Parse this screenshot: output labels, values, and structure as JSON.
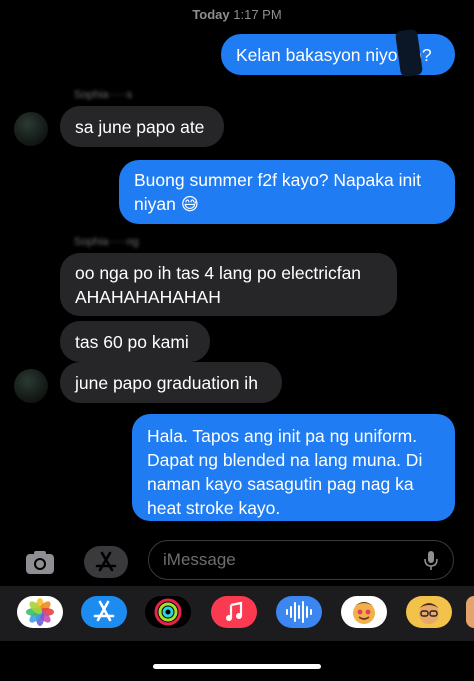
{
  "header": {
    "timestamp_day": "Today",
    "timestamp_time": "1:17 PM"
  },
  "messages": [
    {
      "text": "Kelan bakasyon niyo po?"
    },
    {
      "text": "sa june papo ate"
    },
    {
      "line1": "Buong summer f2f kayo? Napaka init",
      "line2": "niyan 😅"
    },
    {
      "line1": "oo nga po ih tas 4 lang po electricfan",
      "line2": "AHAHAHAHAHAH"
    },
    {
      "text": "tas 60 po kami"
    },
    {
      "text": "june papo graduation ih"
    },
    {
      "line1": "Hala. Tapos ang init pa ng uniform.",
      "line2": "Dapat ng blended na lang muna. Di",
      "line3": "naman kayo sasagutin pag nag ka",
      "line4": "heat stroke kayo."
    }
  ],
  "compose": {
    "placeholder": "iMessage"
  },
  "app_tray": [
    {
      "icon": "photos-icon"
    },
    {
      "icon": "app-store-icon"
    },
    {
      "icon": "fitness-icon"
    },
    {
      "icon": "music-icon"
    },
    {
      "icon": "audio-message-icon"
    },
    {
      "icon": "memoji-stickers-icon"
    },
    {
      "icon": "memoji-icon"
    }
  ],
  "colors": {
    "sent": "#1f7cf3",
    "received": "#262629",
    "background": "#000000"
  }
}
